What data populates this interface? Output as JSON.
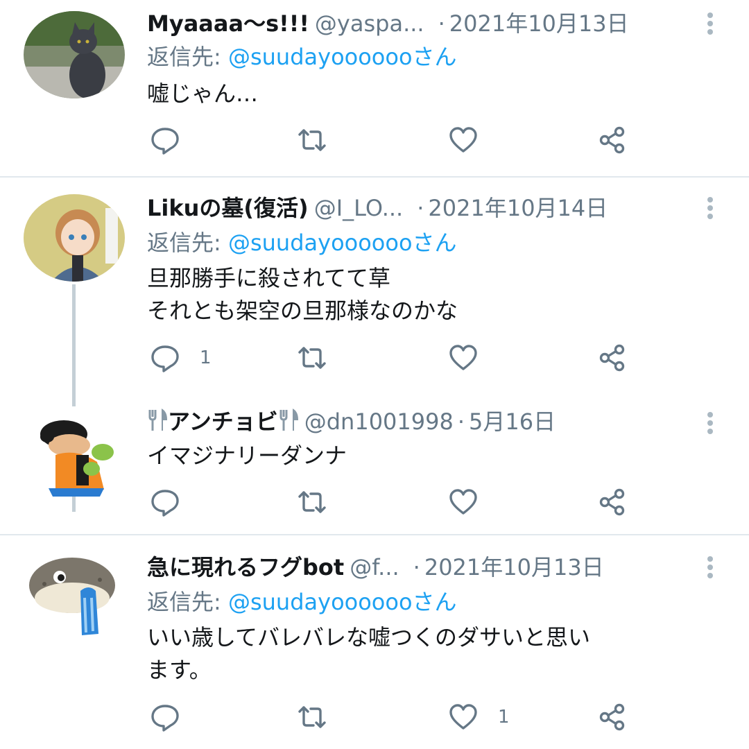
{
  "tweets": [
    {
      "name": "Myaaaa～s!!!",
      "handle": "@yaspa...",
      "date": "2021年10月13日",
      "reply_prefix": "返信先: ",
      "reply_to": "@suudayoooooo",
      "reply_suffix": "さん",
      "text": "嘘じゃん…",
      "reply_count": "",
      "retweet_count": "",
      "like_count": ""
    },
    {
      "name": "Likuの墓(復活)",
      "handle": "@I_LO...",
      "date": "2021年10月14日",
      "reply_prefix": "返信先: ",
      "reply_to": "@suudayoooooo",
      "reply_suffix": "さん",
      "text": "旦那勝手に殺されてて草\nそれとも架空の旦那様なのかな",
      "reply_count": "1",
      "retweet_count": "",
      "like_count": ""
    },
    {
      "name": "アンチョビ",
      "handle": "@dn1001998",
      "date": "5月16日",
      "text": "イマジナリーダンナ",
      "reply_count": "",
      "retweet_count": "",
      "like_count": ""
    },
    {
      "name": "急に現れるフグbot",
      "handle": "@f...",
      "date": "2021年10月13日",
      "reply_prefix": "返信先: ",
      "reply_to": "@suudayoooooo",
      "reply_suffix": "さん",
      "text": "いい歳してバレバレな嘘つくのダサいと思い\nます。",
      "reply_count": "",
      "retweet_count": "",
      "like_count": "1"
    }
  ],
  "icons": {
    "reply": "reply-icon",
    "retweet": "retweet-icon",
    "like": "heart-icon",
    "share": "share-icon",
    "more": "more-vertical-icon",
    "fork_knife": "fork-knife-icon"
  },
  "colors": {
    "text": "#14171a",
    "muted": "#657786",
    "mention": "#1da1f2",
    "icon": "#657786",
    "divider": "#e1e8ed"
  },
  "dot_separator": "·"
}
